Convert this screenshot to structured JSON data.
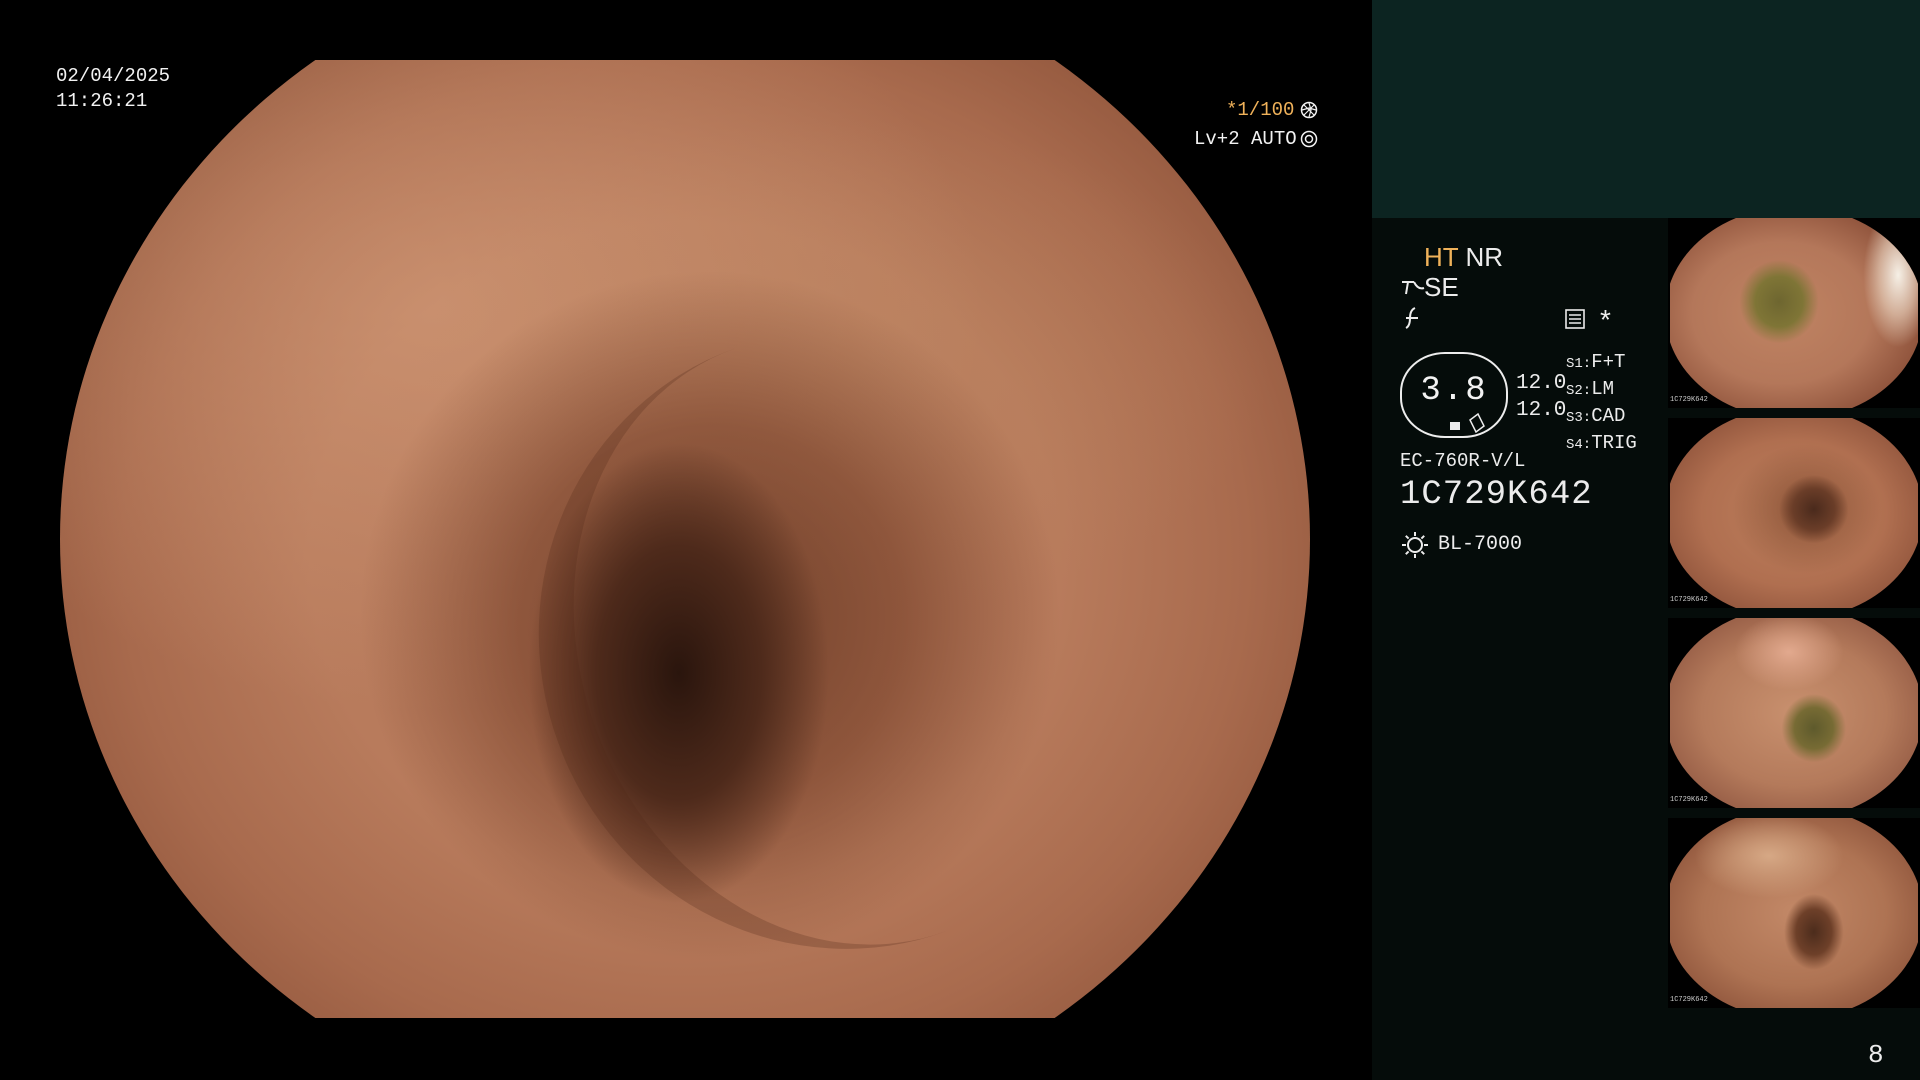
{
  "main_view": {
    "date": "02/04/2025",
    "time": "11:26:21",
    "shutter": "*1/100",
    "shutter_icon": "iris-icon",
    "iris_mode": "Lv+2 AUTO",
    "iris_icon": "light-mode-icon"
  },
  "side_panel": {
    "ht_label": "HT",
    "nr_label": "NR",
    "se_label": "SE",
    "memo_icon": "memo-icon",
    "asterisk": "*",
    "zoom_value": "3.8",
    "values": [
      "12.0",
      "12.0"
    ],
    "switch_settings": [
      {
        "key": "S1:",
        "value": "F+T"
      },
      {
        "key": "S2:",
        "value": "LM"
      },
      {
        "key": "S3:",
        "value": "CAD"
      },
      {
        "key": "S4:",
        "value": "TRIG"
      }
    ],
    "scope_model": "EC-760R-V/L",
    "serial_number": "1C729K642",
    "light_source": "BL-7000",
    "page_number": "8"
  },
  "thumbnails": [
    {
      "id": "1C729K642"
    },
    {
      "id": "1C729K642"
    },
    {
      "id": "1C729K642"
    },
    {
      "id": "1C729K642"
    }
  ]
}
